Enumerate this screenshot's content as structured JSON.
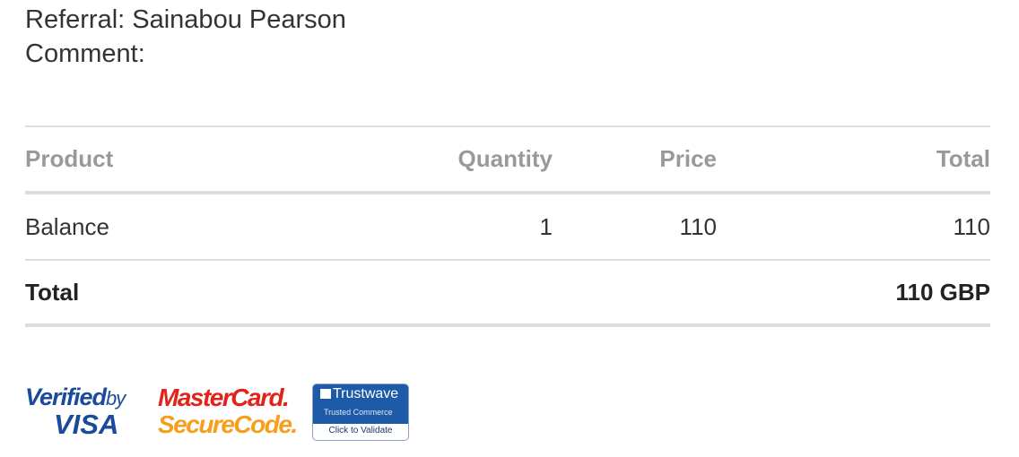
{
  "order_info": {
    "referral_label": "Referral:",
    "referral_name": "Sainabou Pearson",
    "comment_label": "Comment:",
    "comment_value": ""
  },
  "table": {
    "headers": {
      "product": "Product",
      "quantity": "Quantity",
      "price": "Price",
      "total": "Total"
    },
    "rows": [
      {
        "product": "Balance",
        "quantity": "1",
        "price": "110",
        "total": "110"
      }
    ],
    "footer": {
      "label": "Total",
      "amount": "110 GBP"
    }
  },
  "badges": {
    "verified_by_visa": {
      "line1": "Verified",
      "line1_by": "by",
      "line2": "VISA"
    },
    "mastercard": {
      "line1": "MasterCard.",
      "line2": "SecureCode."
    },
    "trustwave": {
      "brand": "Trustwave",
      "sub": "Trusted Commerce",
      "cta": "Click to Validate"
    }
  },
  "colors": {
    "visa_blue": "#1a4a9a",
    "visa_gold": "#f0a500",
    "mastercard_red": "#e2231a",
    "mastercard_orange": "#f79e1b",
    "trustwave_blue": "#1d5aa8",
    "header_gray": "#999999",
    "rule_gray": "#dddddd"
  }
}
